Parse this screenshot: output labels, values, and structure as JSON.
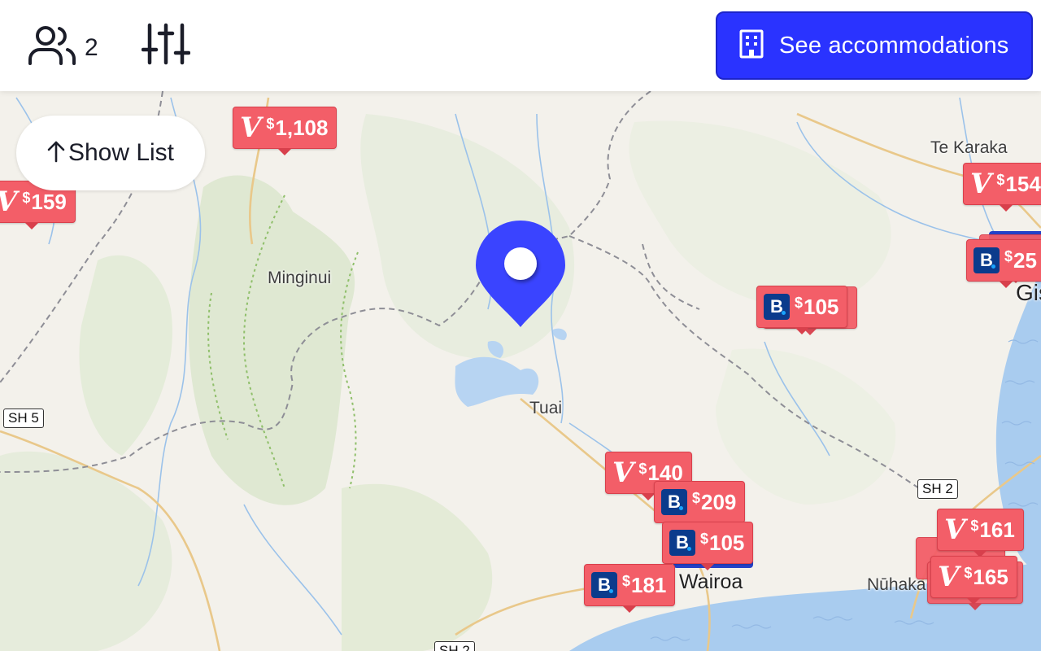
{
  "header": {
    "guests_icon": "users-icon",
    "guest_count": "2",
    "filters_icon": "sliders-icon",
    "cta_icon": "building-icon",
    "cta_label": "See accommodations",
    "cta_color": "#2a33ff"
  },
  "show_list": {
    "icon": "arrow-up-icon",
    "label": "Show List"
  },
  "map": {
    "places": [
      "Te Karaka",
      "Minginui",
      "Tuai",
      "Wairoa",
      "Nūhaka",
      "Gis"
    ],
    "road_shields": [
      "SH 5",
      "SH 2",
      "SH 2"
    ],
    "location_pin": "location-pin-icon",
    "pin_color": "#3a44ff"
  },
  "markers": [
    {
      "provider": "V",
      "price": "1,108"
    },
    {
      "provider": "V",
      "price": "159"
    },
    {
      "provider": "V",
      "price": "154"
    },
    {
      "provider": "B",
      "price": "25"
    },
    {
      "provider": "B",
      "price": "105"
    },
    {
      "provider": "V",
      "price": "140"
    },
    {
      "provider": "B",
      "price": "209"
    },
    {
      "provider": "B",
      "price": "105"
    },
    {
      "provider": "B",
      "price": "181"
    },
    {
      "provider": "V",
      "price": "161"
    },
    {
      "provider": "V",
      "price": "165"
    }
  ],
  "currency_symbol": "$",
  "marker_color": "#f35e68",
  "booking_color": "#0b3b8c"
}
